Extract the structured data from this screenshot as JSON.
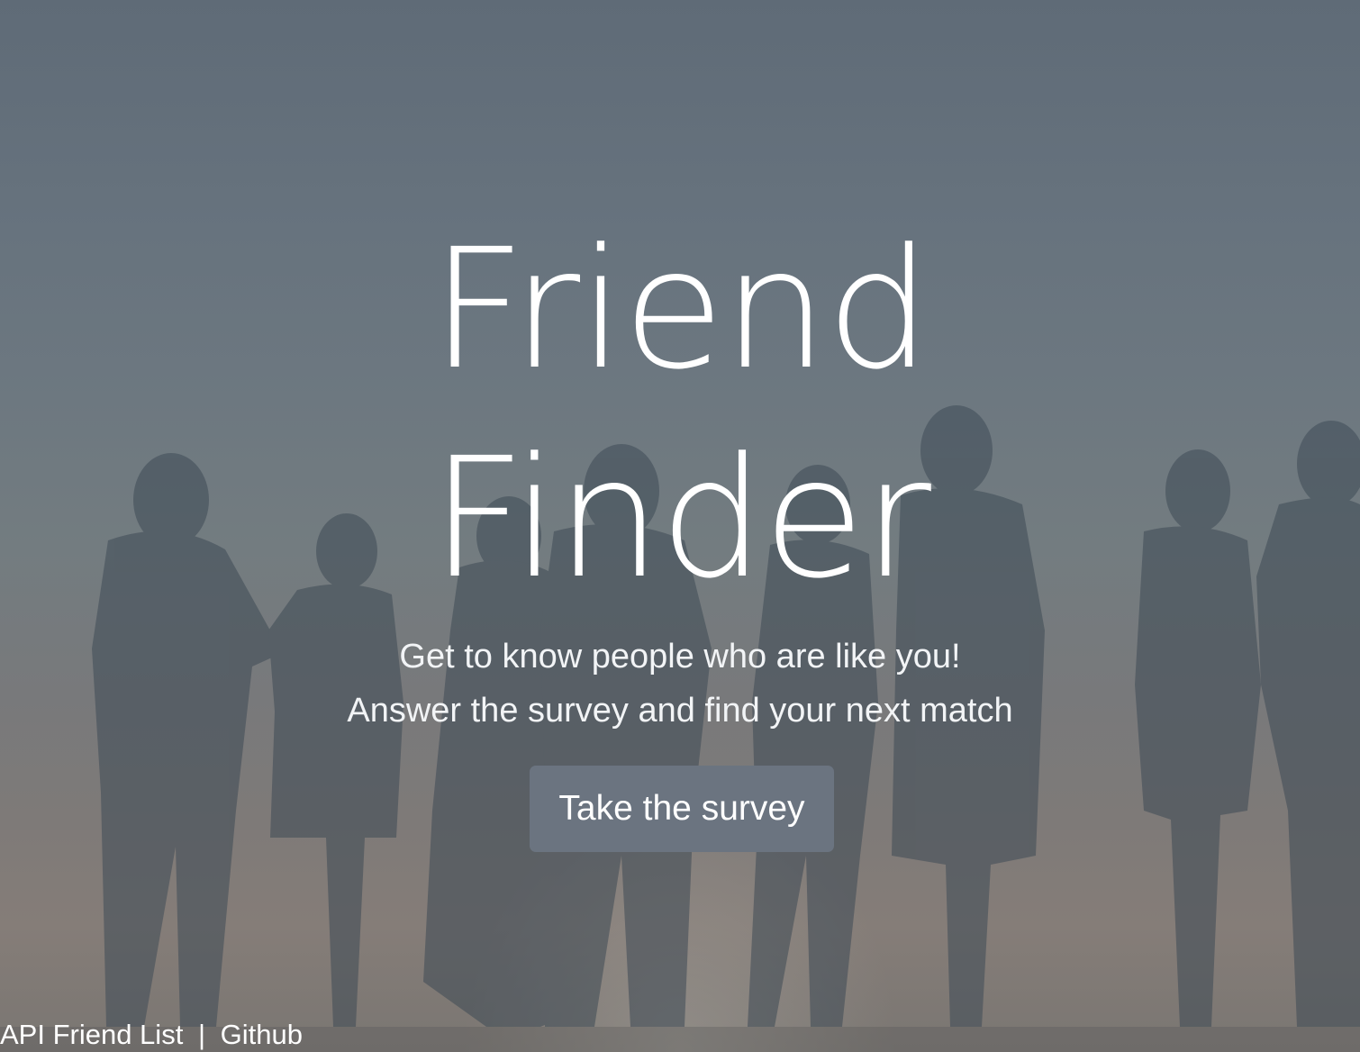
{
  "hero": {
    "title_line1": "Friend",
    "title_line2": "Finder",
    "subtitle_line1": "Get to know people who are like you!",
    "subtitle_line2": "Answer the survey and find your next match",
    "cta_label": "Take the survey"
  },
  "footer": {
    "api_link": "API Friend List",
    "separator": "|",
    "github_link": "Github"
  },
  "colors": {
    "button_bg": "#6b7480",
    "text": "#ffffff"
  }
}
